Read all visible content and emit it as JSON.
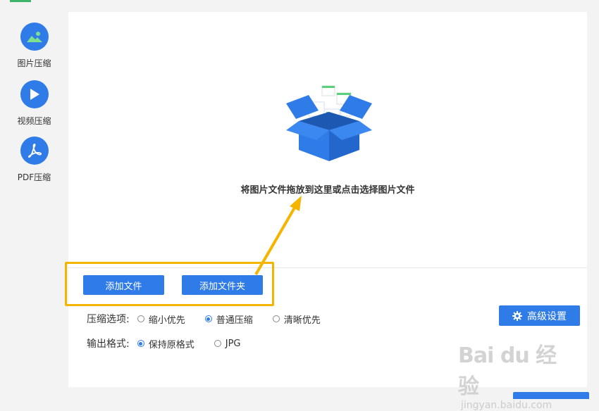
{
  "sidebar": {
    "items": [
      {
        "label": "图片压缩",
        "icon": "image-icon"
      },
      {
        "label": "视频压缩",
        "icon": "play-icon"
      },
      {
        "label": "PDF压缩",
        "icon": "pdf-icon"
      }
    ]
  },
  "dropzone": {
    "text": "将图片文件拖放到这里或点击选择图片文件",
    "icon": "open-box-icon"
  },
  "actions": {
    "add_file": "添加文件",
    "add_folder": "添加文件夹"
  },
  "compress_options": {
    "label": "压缩选项:",
    "options": [
      "缩小优先",
      "普通压缩",
      "清晰优先"
    ],
    "selected": "普通压缩"
  },
  "output_format": {
    "label": "输出格式:",
    "options": [
      "保持原格式",
      "JPG"
    ],
    "selected": "保持原格式"
  },
  "advanced": {
    "label": "高级设置",
    "icon": "gear-icon"
  },
  "watermark": {
    "main": "Bai du 经验",
    "sub": "jingyan.baidu.com"
  },
  "colors": {
    "accent": "#2f7be8",
    "highlight": "#f5b400"
  }
}
